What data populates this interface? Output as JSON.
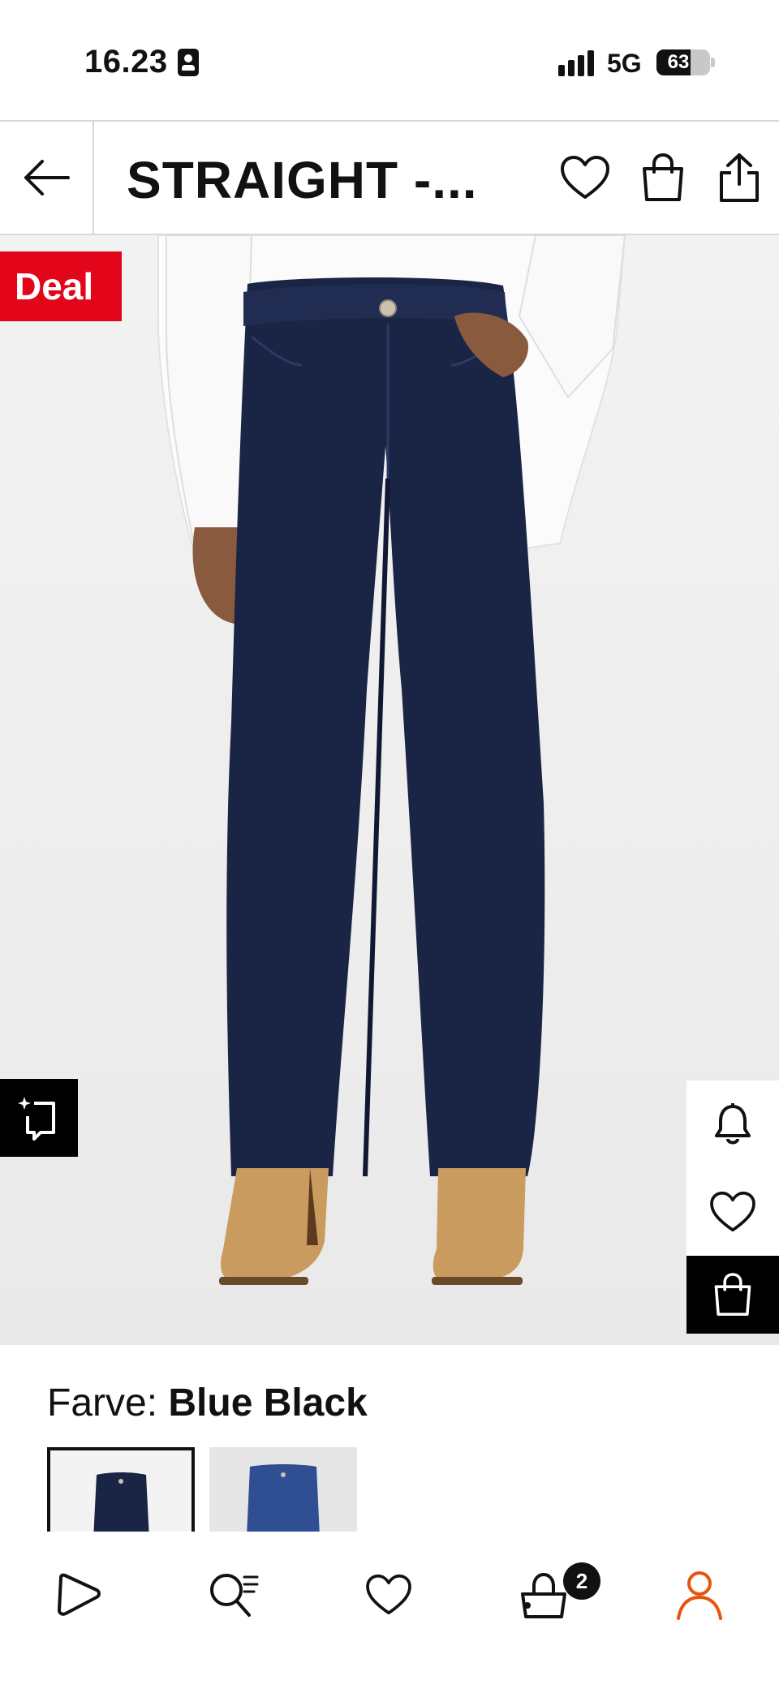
{
  "status_bar": {
    "time": "16.23",
    "network": "5G",
    "battery_level": "63",
    "battery_fraction": 0.63
  },
  "header": {
    "title": "STRAIGHT -..."
  },
  "product": {
    "badge": "Deal",
    "color_label": "Farve:",
    "color_name": "Blue Black"
  },
  "nav": {
    "cart_count": "2",
    "active_color": "#e8540f"
  },
  "colors": {
    "deal_red": "#e3061a",
    "denim_dark": "#1a2444",
    "denim_blue": "#2f4f92"
  },
  "icons": [
    "back-arrow-icon",
    "heart-icon",
    "bag-icon",
    "share-icon",
    "scan-icon",
    "bell-icon",
    "play-icon",
    "search-list-icon",
    "cart-icon",
    "profile-icon"
  ]
}
